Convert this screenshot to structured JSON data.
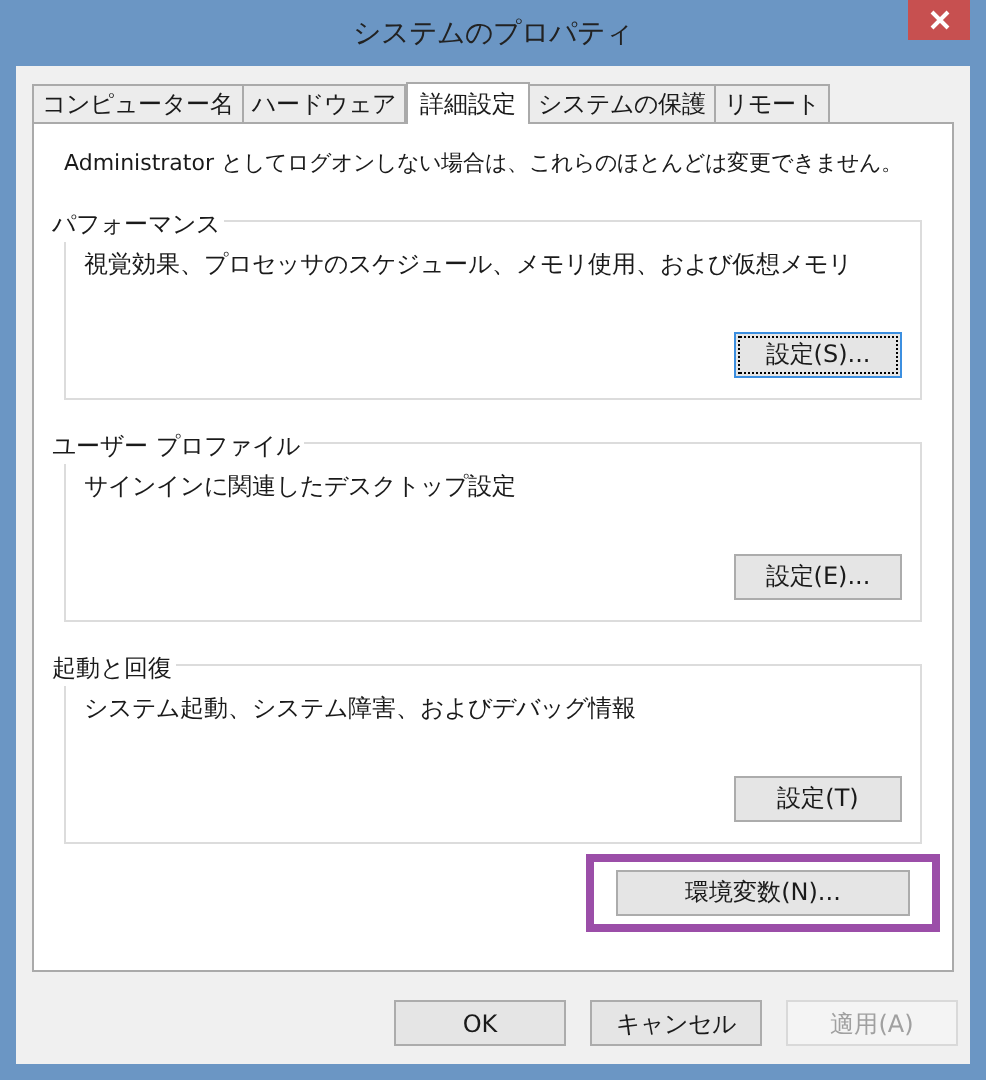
{
  "window": {
    "title": "システムのプロパティ"
  },
  "tabs": [
    {
      "label": "コンピューター名",
      "selected": false
    },
    {
      "label": "ハードウェア",
      "selected": false
    },
    {
      "label": "詳細設定",
      "selected": true
    },
    {
      "label": "システムの保護",
      "selected": false
    },
    {
      "label": "リモート",
      "selected": false
    }
  ],
  "notice": "Administrator としてログオンしない場合は、これらのほとんどは変更できません。",
  "groups": [
    {
      "title": "パフォーマンス",
      "description": "視覚効果、プロセッサのスケジュール、メモリ使用、および仮想メモリ",
      "button": {
        "label": "設定(S)...",
        "focused": true
      }
    },
    {
      "title": "ユーザー プロファイル",
      "description": "サインインに関連したデスクトップ設定",
      "button": {
        "label": "設定(E)...",
        "focused": false
      }
    },
    {
      "title": "起動と回復",
      "description": "システム起動、システム障害、およびデバッグ情報",
      "button": {
        "label": "設定(T)",
        "focused": false
      }
    }
  ],
  "env_button": {
    "label": "環境変数(N)...",
    "highlighted": true
  },
  "buttons": [
    {
      "label": "OK",
      "disabled": false
    },
    {
      "label": "キャンセル",
      "disabled": false
    },
    {
      "label": "適用(A)",
      "disabled": true
    }
  ]
}
